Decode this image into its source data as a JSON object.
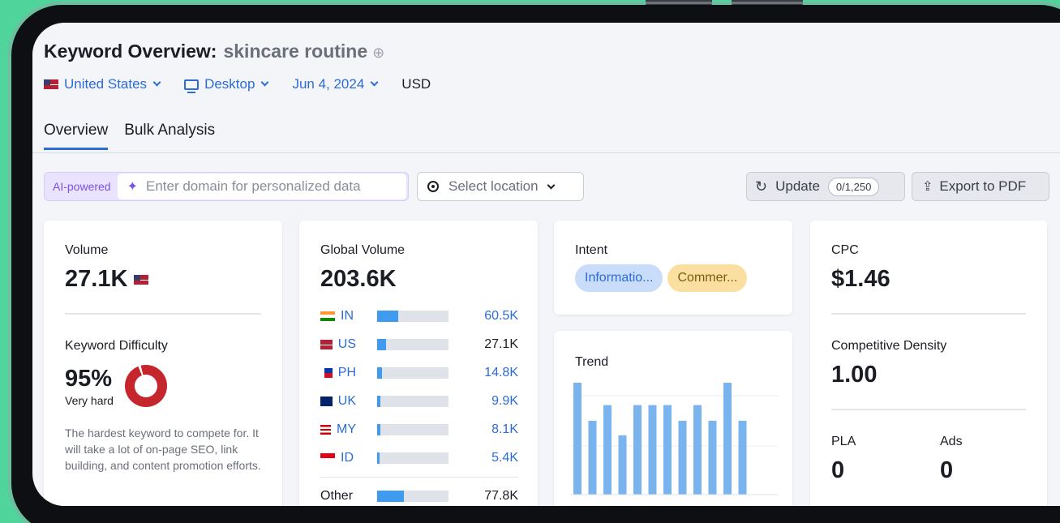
{
  "header": {
    "title_prefix": "Keyword Overview:",
    "keyword": "skincare routine"
  },
  "filters": {
    "country": "United States",
    "device": "Desktop",
    "date": "Jun 4, 2024",
    "currency": "USD"
  },
  "tabs": [
    {
      "label": "Overview",
      "active": true
    },
    {
      "label": "Bulk Analysis",
      "active": false
    }
  ],
  "toolbar": {
    "ai_label": "AI-powered",
    "domain_placeholder": "Enter domain for personalized data",
    "location_placeholder": "Select location",
    "update_label": "Update",
    "update_quota": "0/1,250",
    "export_label": "Export to PDF"
  },
  "volume": {
    "label": "Volume",
    "value": "27.1K"
  },
  "keyword_difficulty": {
    "label": "Keyword Difficulty",
    "value": "95%",
    "level": "Very hard",
    "description": "The hardest keyword to compete for. It will take a lot of on-page SEO, link building, and content promotion efforts.",
    "color": "#c5262e"
  },
  "global_volume": {
    "label": "Global Volume",
    "value": "203.6K",
    "countries": [
      {
        "code": "IN",
        "value": "60.5K",
        "share": 0.3,
        "highlight": true
      },
      {
        "code": "US",
        "value": "27.1K",
        "share": 0.13,
        "highlight": false
      },
      {
        "code": "PH",
        "value": "14.8K",
        "share": 0.07,
        "highlight": true
      },
      {
        "code": "UK",
        "value": "9.9K",
        "share": 0.05,
        "highlight": true
      },
      {
        "code": "MY",
        "value": "8.1K",
        "share": 0.04,
        "highlight": true
      },
      {
        "code": "ID",
        "value": "5.4K",
        "share": 0.03,
        "highlight": true
      }
    ],
    "other": {
      "label": "Other",
      "value": "77.8K",
      "share": 0.38
    }
  },
  "intent": {
    "label": "Intent",
    "tags": [
      "Informatio...",
      "Commer..."
    ]
  },
  "trend": {
    "label": "Trend",
    "values": [
      1.0,
      0.66,
      0.8,
      0.53,
      0.8,
      0.8,
      0.8,
      0.66,
      0.8,
      0.66,
      1.0,
      0.66
    ]
  },
  "cpc": {
    "label": "CPC",
    "value": "$1.46"
  },
  "competitive_density": {
    "label": "Competitive Density",
    "value": "1.00"
  },
  "pla": {
    "label": "PLA",
    "value": "0"
  },
  "ads": {
    "label": "Ads",
    "value": "0"
  },
  "colors": {
    "accent": "#2b6cd6",
    "bar": "#3f9bf0",
    "ai": "#7a52e9",
    "background": "#4fd49b"
  }
}
